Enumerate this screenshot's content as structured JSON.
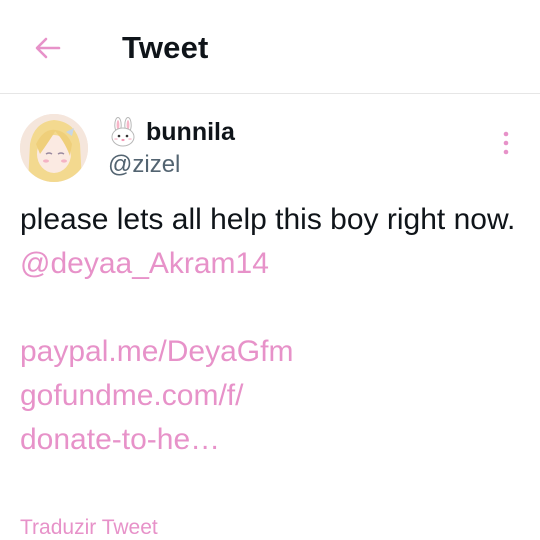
{
  "header": {
    "title": "Tweet",
    "back_icon": "arrow-left-icon",
    "accent_color": "#e792c9"
  },
  "author": {
    "display_name": "bunnila",
    "handle": "@zizel",
    "name_icon": "rabbit-face-icon",
    "avatar_icon": "anime-avatar"
  },
  "more_icon": "more-vertical-icon",
  "tweet": {
    "text_line": "please lets all help this boy right now.",
    "mention": "@deyaa_Akram14",
    "link_paypal": "paypal.me/DeyaGfm",
    "link_gofundme_1": "gofundme.com/f/",
    "link_gofundme_2": "donate-to-he…"
  },
  "translate_label": "Traduzir Tweet"
}
